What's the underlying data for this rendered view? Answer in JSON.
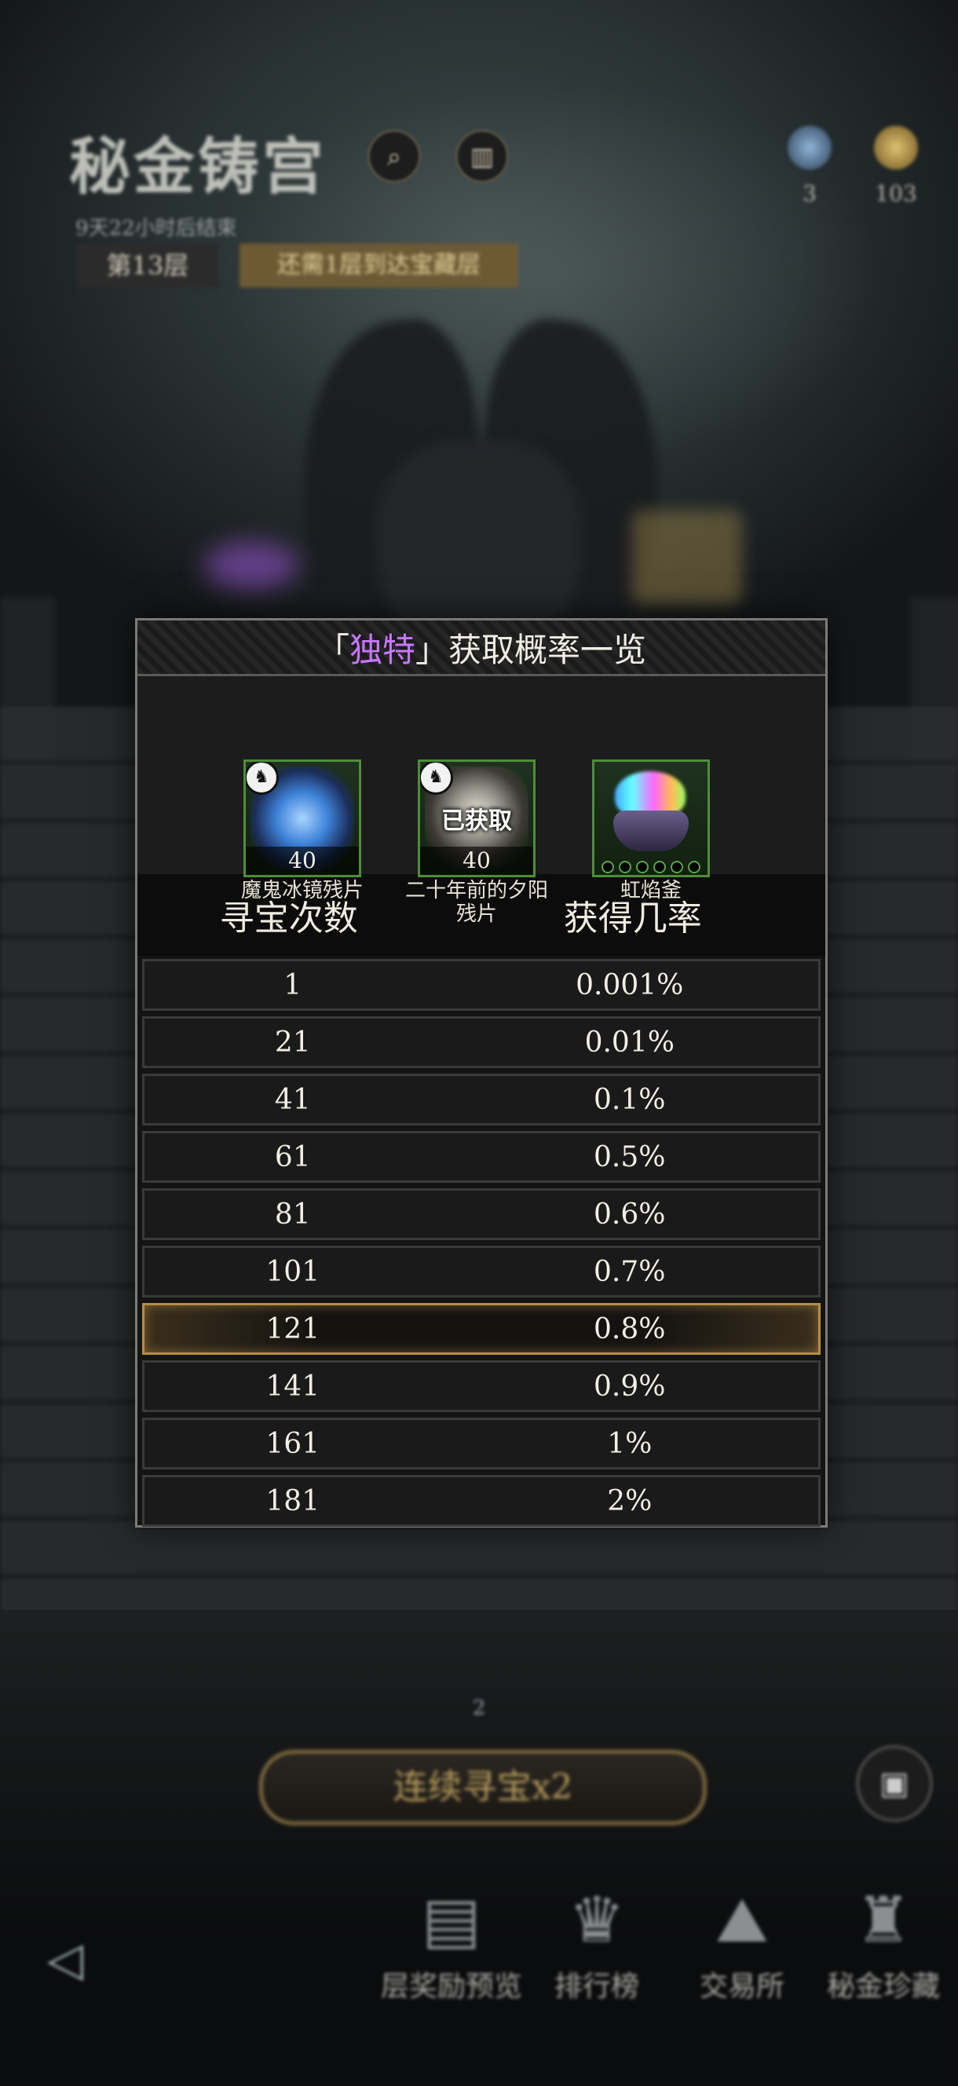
{
  "header": {
    "title": "秘金铸宫",
    "subtitle": "9天22小时后结束",
    "floor_label": "第13层",
    "floor_hint": "还需1层到达宝藏层"
  },
  "currencies": [
    {
      "icon": "crystal-icon",
      "value": "3",
      "color": "#5a7a9a"
    },
    {
      "icon": "gold-coin-icon",
      "value": "103",
      "color": "#a8893c"
    }
  ],
  "modal": {
    "title_prefix": "「",
    "title_highlight": "独特",
    "title_suffix": "」获取概率一览",
    "highlight_color": "#c877ff",
    "items": [
      {
        "name": "魔鬼冰镜残片",
        "count": "40",
        "badge_icon": "rabbit-badge-icon",
        "status": ""
      },
      {
        "name": "二十年前的夕阳残片",
        "count": "40",
        "badge_icon": "rabbit-badge-icon",
        "status": "已获取"
      },
      {
        "name": "虹焰釜",
        "count": "",
        "badge_icon": "",
        "status": ""
      }
    ],
    "table": {
      "headers": [
        "寻宝次数",
        "获得几率"
      ],
      "rows": [
        {
          "count": "1",
          "rate": "0.001%"
        },
        {
          "count": "21",
          "rate": "0.01%"
        },
        {
          "count": "41",
          "rate": "0.1%"
        },
        {
          "count": "61",
          "rate": "0.5%"
        },
        {
          "count": "81",
          "rate": "0.6%"
        },
        {
          "count": "101",
          "rate": "0.7%"
        },
        {
          "count": "121",
          "rate": "0.8%",
          "current": true
        },
        {
          "count": "141",
          "rate": "0.9%"
        },
        {
          "count": "161",
          "rate": "1%"
        },
        {
          "count": "181",
          "rate": "2%"
        }
      ],
      "highlight_color": "#b58e44"
    }
  },
  "bottom": {
    "hunt_count": "2",
    "hunt_button": "连续寻宝x2",
    "nav": [
      {
        "label": "层奖励预览",
        "icon": "reward-preview-icon"
      },
      {
        "label": "排行榜",
        "icon": "trophy-icon"
      },
      {
        "label": "交易所",
        "icon": "exchange-icon"
      },
      {
        "label": "秘金珍藏",
        "icon": "collection-icon"
      }
    ]
  }
}
